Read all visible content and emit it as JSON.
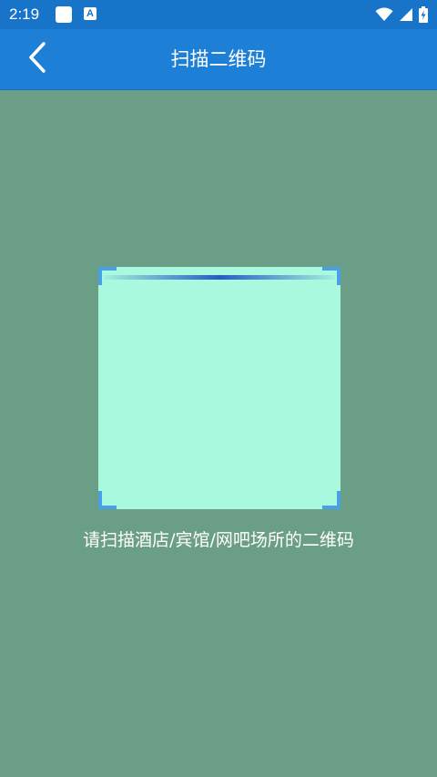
{
  "status_bar": {
    "time": "2:19",
    "notification_letter": "A",
    "icons": [
      "notification-square-icon",
      "accessibility-a-icon",
      "wifi-icon",
      "cell-signal-icon",
      "battery-charging-icon"
    ]
  },
  "header": {
    "title": "扫描二维码",
    "back_icon": "chevron-left-icon",
    "background_color": "#1e7fd6"
  },
  "scanner": {
    "frame_color": "#a8f9de",
    "corner_color": "#4aa0e6",
    "scan_line_color": "#2154c4",
    "hint": "请扫描酒店/宾馆/网吧场所的二维码"
  },
  "colors": {
    "status_bar": "#1874c9",
    "page_background": "#6b9e87"
  }
}
